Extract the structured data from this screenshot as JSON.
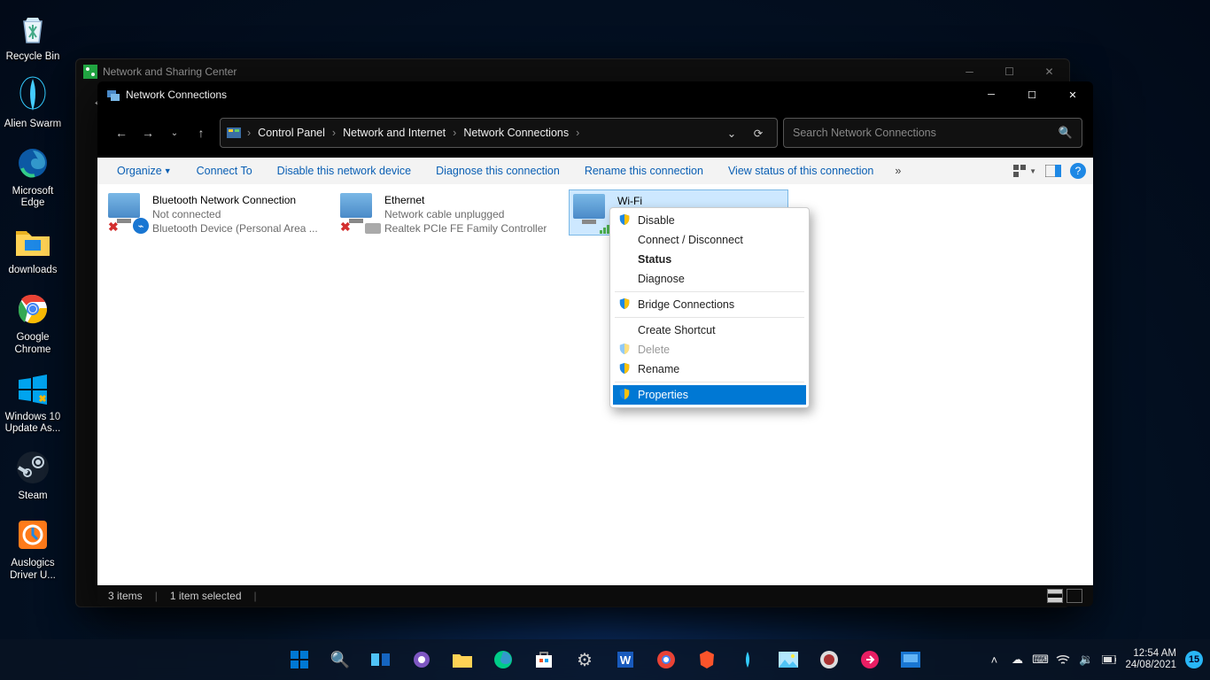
{
  "desktop": {
    "icons": [
      {
        "label": "Recycle Bin",
        "glyph": "recycle"
      },
      {
        "label": "Alien Swarm",
        "glyph": "alien"
      },
      {
        "label": "Microsoft Edge",
        "glyph": "edge"
      },
      {
        "label": "downloads",
        "glyph": "folder"
      },
      {
        "label": "Google Chrome",
        "glyph": "chrome"
      },
      {
        "label": "Windows 10 Update As...",
        "glyph": "win10"
      },
      {
        "label": "Steam",
        "glyph": "steam"
      },
      {
        "label": "Auslogics Driver U...",
        "glyph": "auslogics"
      }
    ]
  },
  "parent_window": {
    "title": "Network and Sharing Center"
  },
  "window": {
    "title": "Network Connections",
    "breadcrumb": [
      "Control Panel",
      "Network and Internet",
      "Network Connections"
    ],
    "search_placeholder": "Search Network Connections"
  },
  "toolbar": {
    "organize": "Organize",
    "items": [
      "Connect To",
      "Disable this network device",
      "Diagnose this connection",
      "Rename this connection",
      "View status of this connection"
    ],
    "overflow": "»"
  },
  "adapters": [
    {
      "name": "Bluetooth Network Connection",
      "status": "Not connected",
      "device": "Bluetooth Device (Personal Area ...",
      "badge": "bt",
      "error": true
    },
    {
      "name": "Ethernet",
      "status": "Network cable unplugged",
      "device": "Realtek PCIe FE Family Controller",
      "badge": "eth",
      "error": true
    },
    {
      "name": "Wi-Fi",
      "status": "",
      "device": "",
      "badge": "wifi",
      "error": false,
      "selected": true
    }
  ],
  "context_menu": {
    "items": [
      {
        "label": "Disable",
        "shield": true
      },
      {
        "label": "Connect / Disconnect"
      },
      {
        "label": "Status",
        "bold": true
      },
      {
        "label": "Diagnose"
      },
      {
        "sep": true
      },
      {
        "label": "Bridge Connections",
        "shield": true
      },
      {
        "sep": true
      },
      {
        "label": "Create Shortcut"
      },
      {
        "label": "Delete",
        "shield": true,
        "disabled": true
      },
      {
        "label": "Rename",
        "shield": true
      },
      {
        "sep": true
      },
      {
        "label": "Properties",
        "shield": true,
        "highlighted": true
      }
    ]
  },
  "statusbar": {
    "count": "3 items",
    "selection": "1 item selected"
  },
  "taskbar": {
    "time": "12:54 AM",
    "date": "24/08/2021",
    "notif_count": "15",
    "apps": [
      "start",
      "search",
      "taskview",
      "chat",
      "explorer",
      "edge",
      "store",
      "settings",
      "word",
      "chrome",
      "brave",
      "app1",
      "photos",
      "app2",
      "app3",
      "app4"
    ]
  }
}
